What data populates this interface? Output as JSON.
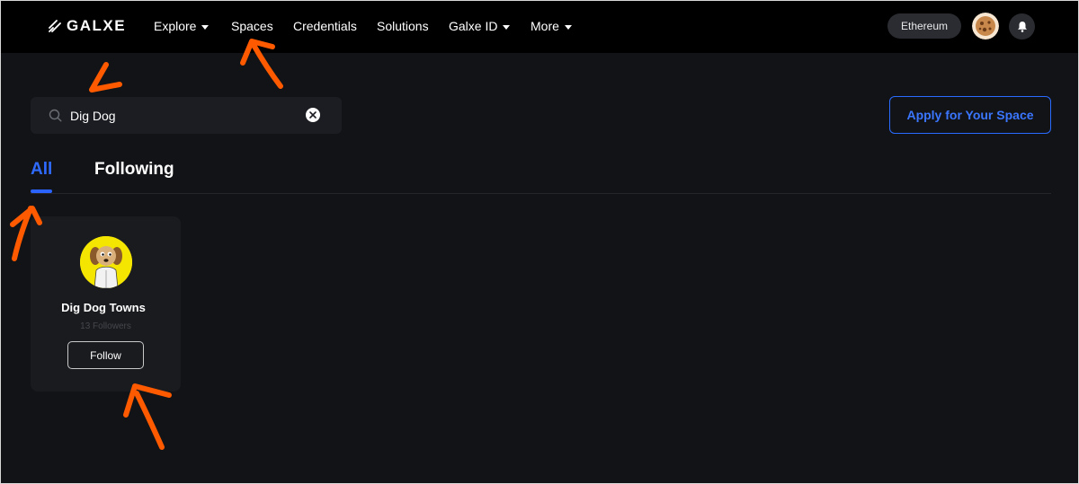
{
  "nav": {
    "logo": "GALXE",
    "items": [
      {
        "label": "Explore",
        "dropdown": true
      },
      {
        "label": "Spaces",
        "dropdown": false
      },
      {
        "label": "Credentials",
        "dropdown": false
      },
      {
        "label": "Solutions",
        "dropdown": false
      },
      {
        "label": "Galxe ID",
        "dropdown": true
      },
      {
        "label": "More",
        "dropdown": true
      }
    ],
    "network": "Ethereum",
    "icons": {
      "avatar": "user-avatar",
      "notifications": "bell-icon"
    }
  },
  "search": {
    "value": "Dig Dog",
    "icon": "search-icon",
    "clear_icon": "clear-icon"
  },
  "apply_button": "Apply for Your Space",
  "tabs": [
    {
      "label": "All",
      "active": true
    },
    {
      "label": "Following",
      "active": false
    }
  ],
  "spaces": [
    {
      "name": "Dig Dog Towns",
      "followers": "13 Followers",
      "follow_label": "Follow",
      "avatar_icon": "dig-dog-avatar"
    }
  ],
  "colors": {
    "background": "#121316",
    "navbar": "#000000",
    "accent_blue": "#2f6bff",
    "card": "#1a1b1f",
    "annotation_arrow": "#ff5a00"
  }
}
